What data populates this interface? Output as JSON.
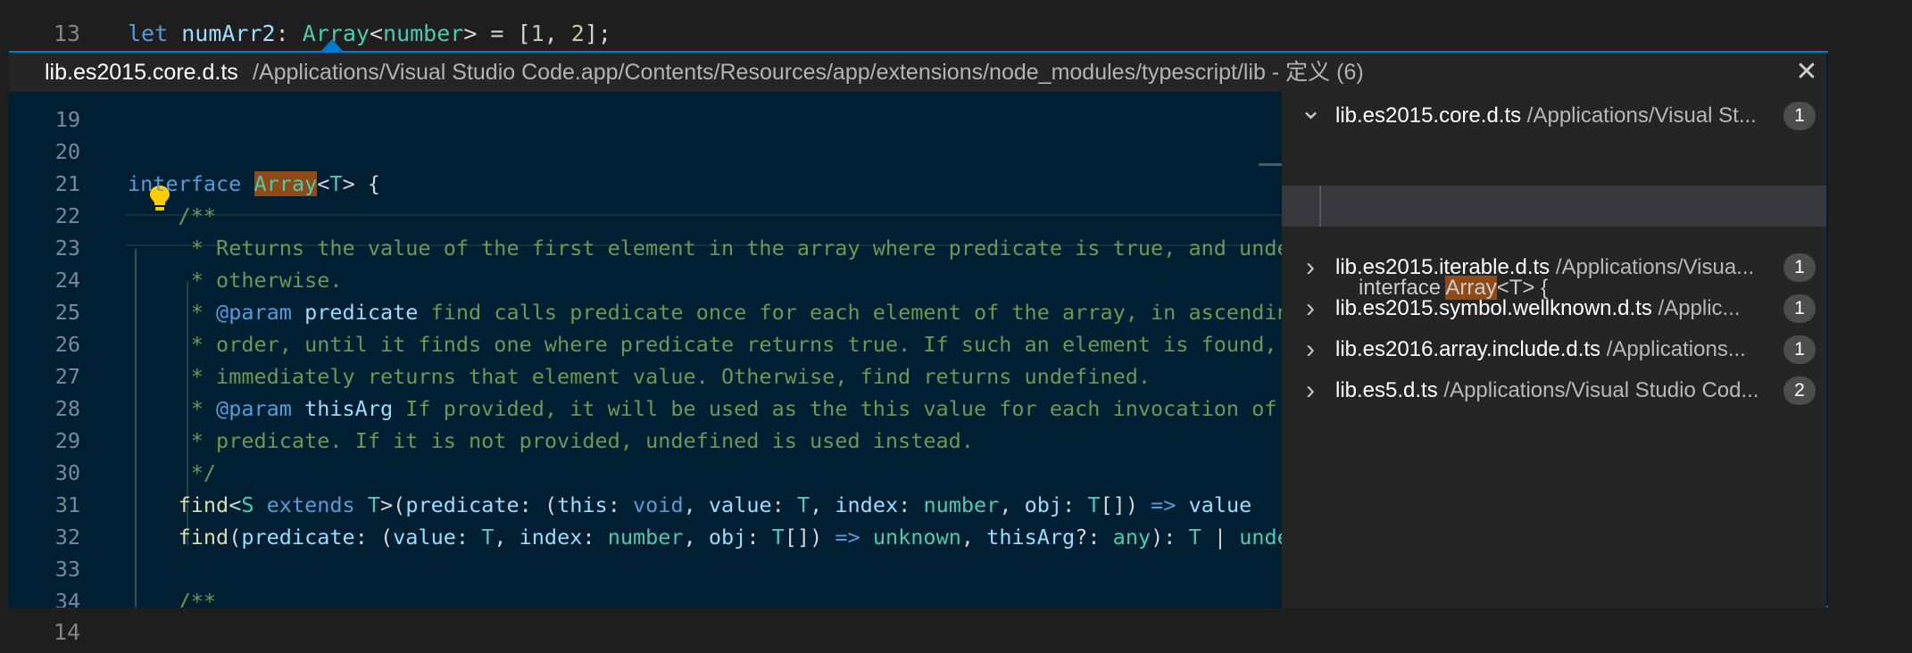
{
  "outer_lines": [
    {
      "number": "13",
      "tokens": [
        [
          "kw",
          "let"
        ],
        [
          "plain",
          " "
        ],
        [
          "va",
          "numArr2"
        ],
        [
          "plain",
          ": "
        ],
        [
          "ty",
          "Array"
        ],
        [
          "plain",
          "<"
        ],
        [
          "ty",
          "number"
        ],
        [
          "plain",
          "> = ["
        ],
        [
          "nu",
          "1"
        ],
        [
          "plain",
          ", "
        ],
        [
          "nu",
          "2"
        ],
        [
          "plain",
          "];"
        ]
      ]
    },
    {
      "number": "14",
      "tokens": []
    }
  ],
  "peek": {
    "title": "lib.es2015.core.d.ts",
    "path": "/Applications/Visual Studio Code.app/Contents/Resources/app/extensions/node_modules/typescript/lib",
    "meta": " - 定义 (6)",
    "close_icon": "close-icon",
    "code_lines": [
      {
        "number": "19",
        "tokens": []
      },
      {
        "number": "20",
        "tokens": []
      },
      {
        "number": "21",
        "tokens": [
          [
            "kw",
            "interface"
          ],
          [
            "plain",
            " "
          ],
          [
            "hl",
            "Array"
          ],
          [
            "plain",
            "<"
          ],
          [
            "ty",
            "T"
          ],
          [
            "plain",
            "> {"
          ]
        ]
      },
      {
        "number": "22",
        "tokens": [
          [
            "plain",
            "    "
          ],
          [
            "cm",
            "/**"
          ]
        ]
      },
      {
        "number": "23",
        "tokens": [
          [
            "plain",
            "     "
          ],
          [
            "cm",
            "* Returns the value of the first element in the array where predicate is true, and undefined"
          ]
        ]
      },
      {
        "number": "24",
        "tokens": [
          [
            "plain",
            "     "
          ],
          [
            "cm",
            "* otherwise."
          ]
        ]
      },
      {
        "number": "25",
        "tokens": [
          [
            "plain",
            "     "
          ],
          [
            "cm",
            "* "
          ],
          [
            "kw",
            "@param"
          ],
          [
            "plain",
            " "
          ],
          [
            "va",
            "predicate"
          ],
          [
            "cm",
            " find calls predicate once for each element of the array, in ascending"
          ]
        ]
      },
      {
        "number": "26",
        "tokens": [
          [
            "plain",
            "     "
          ],
          [
            "cm",
            "* order, until it finds one where predicate returns true. If such an element is found, find"
          ]
        ]
      },
      {
        "number": "27",
        "tokens": [
          [
            "plain",
            "     "
          ],
          [
            "cm",
            "* immediately returns that element value. Otherwise, find returns undefined."
          ]
        ]
      },
      {
        "number": "28",
        "tokens": [
          [
            "plain",
            "     "
          ],
          [
            "cm",
            "* "
          ],
          [
            "kw",
            "@param"
          ],
          [
            "plain",
            " "
          ],
          [
            "va",
            "thisArg"
          ],
          [
            "cm",
            " If provided, it will be used as the this value for each invocation of"
          ]
        ]
      },
      {
        "number": "29",
        "tokens": [
          [
            "plain",
            "     "
          ],
          [
            "cm",
            "* predicate. If it is not provided, undefined is used instead."
          ]
        ]
      },
      {
        "number": "30",
        "tokens": [
          [
            "plain",
            "     "
          ],
          [
            "cm",
            "*/"
          ]
        ]
      },
      {
        "number": "31",
        "tokens": [
          [
            "plain",
            "    "
          ],
          [
            "fn",
            "find"
          ],
          [
            "plain",
            "<"
          ],
          [
            "ty",
            "S"
          ],
          [
            "plain",
            " "
          ],
          [
            "kw",
            "extends"
          ],
          [
            "plain",
            " "
          ],
          [
            "ty",
            "T"
          ],
          [
            "plain",
            ">("
          ],
          [
            "va",
            "predicate"
          ],
          [
            "plain",
            ": ("
          ],
          [
            "va",
            "this"
          ],
          [
            "plain",
            ": "
          ],
          [
            "kw",
            "void"
          ],
          [
            "plain",
            ", "
          ],
          [
            "va",
            "value"
          ],
          [
            "plain",
            ": "
          ],
          [
            "ty",
            "T"
          ],
          [
            "plain",
            ", "
          ],
          [
            "va",
            "index"
          ],
          [
            "plain",
            ": "
          ],
          [
            "ty",
            "number"
          ],
          [
            "plain",
            ", "
          ],
          [
            "va",
            "obj"
          ],
          [
            "plain",
            ": "
          ],
          [
            "ty",
            "T"
          ],
          [
            "plain",
            "[]) "
          ],
          [
            "kw",
            "=>"
          ],
          [
            "plain",
            " "
          ],
          [
            "va",
            "value"
          ]
        ]
      },
      {
        "number": "32",
        "tokens": [
          [
            "plain",
            "    "
          ],
          [
            "fn",
            "find"
          ],
          [
            "plain",
            "("
          ],
          [
            "va",
            "predicate"
          ],
          [
            "plain",
            ": ("
          ],
          [
            "va",
            "value"
          ],
          [
            "plain",
            ": "
          ],
          [
            "ty",
            "T"
          ],
          [
            "plain",
            ", "
          ],
          [
            "va",
            "index"
          ],
          [
            "plain",
            ": "
          ],
          [
            "ty",
            "number"
          ],
          [
            "plain",
            ", "
          ],
          [
            "va",
            "obj"
          ],
          [
            "plain",
            ": "
          ],
          [
            "ty",
            "T"
          ],
          [
            "plain",
            "[]) "
          ],
          [
            "kw",
            "=>"
          ],
          [
            "plain",
            " "
          ],
          [
            "ty",
            "unknown"
          ],
          [
            "plain",
            ", "
          ],
          [
            "va",
            "thisArg"
          ],
          [
            "plain",
            "?: "
          ],
          [
            "ty",
            "any"
          ],
          [
            "plain",
            "): "
          ],
          [
            "ty",
            "T"
          ],
          [
            "plain",
            " | "
          ],
          [
            "ty",
            "undefined"
          ]
        ]
      },
      {
        "number": "33",
        "tokens": []
      },
      {
        "number": "34",
        "tokens": [
          [
            "plain",
            "    "
          ],
          [
            "cm",
            "/**"
          ]
        ]
      }
    ]
  },
  "results": [
    {
      "file": "lib.es2015.core.d.ts",
      "path": "/Applications/Visual St...",
      "count": "1",
      "expanded": true
    },
    {
      "file": "lib.es2015.iterable.d.ts",
      "path": "/Applications/Visua...",
      "count": "1",
      "expanded": false
    },
    {
      "file": "lib.es2015.symbol.wellknown.d.ts",
      "path": "/Applic...",
      "count": "1",
      "expanded": false
    },
    {
      "file": "lib.es2016.array.include.d.ts",
      "path": "/Applications...",
      "count": "1",
      "expanded": false
    },
    {
      "file": "lib.es5.d.ts",
      "path": "/Applications/Visual Studio Cod...",
      "count": "2",
      "expanded": false
    }
  ],
  "result_child": {
    "before": "interface ",
    "match": "Array",
    "after": "<T> {"
  },
  "colors": {
    "accent": "#007acc",
    "peek_bg": "#001f33",
    "match_highlight": "#8f4a18"
  }
}
